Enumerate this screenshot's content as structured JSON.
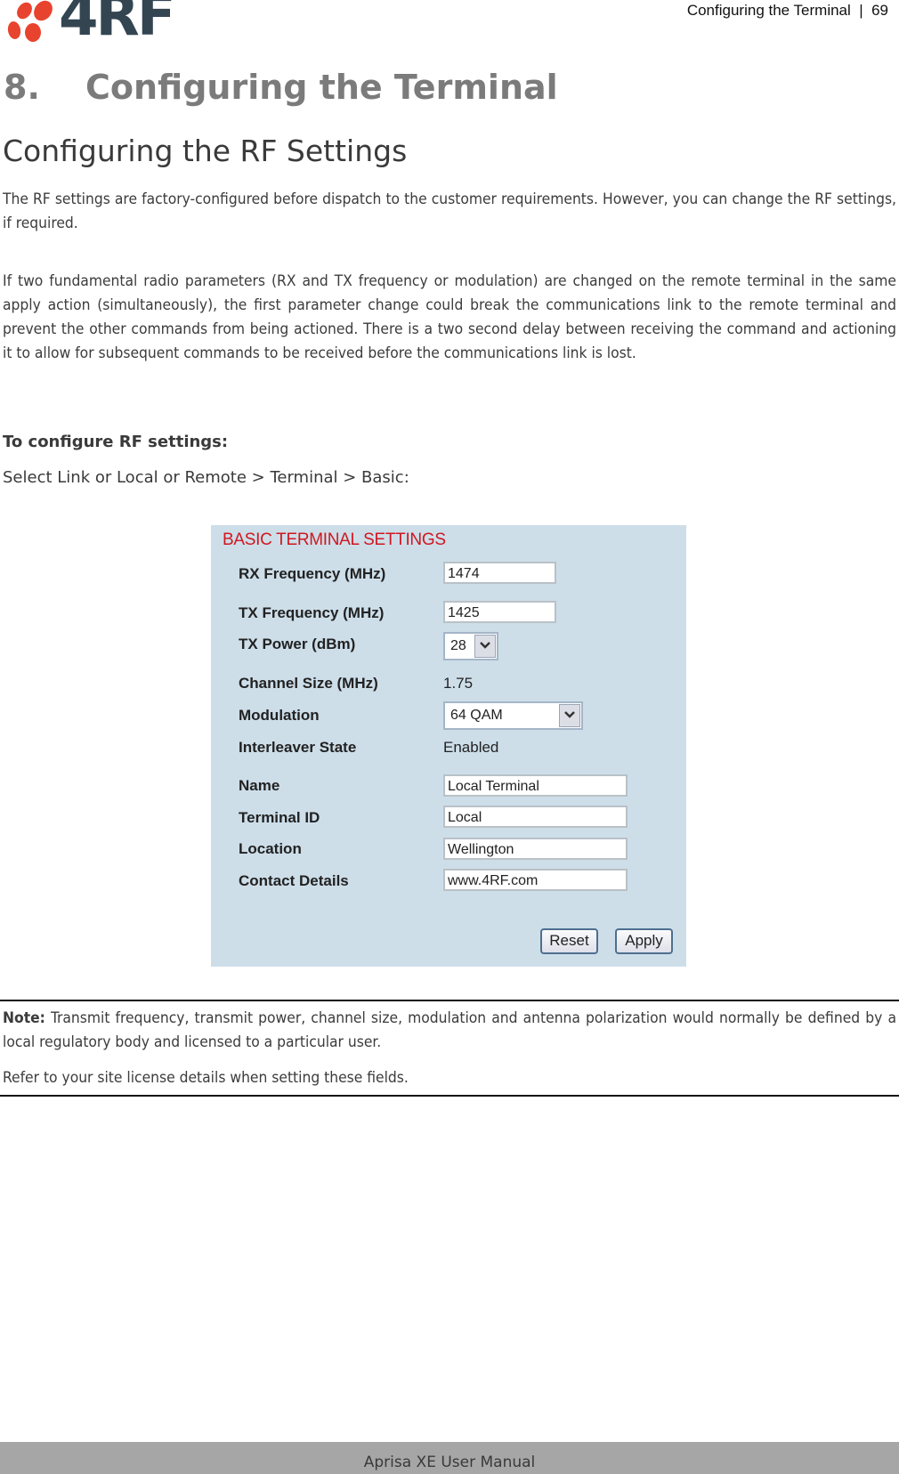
{
  "header": {
    "logo_text": "4RF",
    "running_head": "Configuring the Terminal  |  69"
  },
  "chapter": {
    "number": "8.",
    "title": "Configuring the Terminal"
  },
  "section": {
    "title": "Configuring the RF Settings"
  },
  "paragraphs": [
    "The RF settings are factory-configured before dispatch to the customer requirements. However, you can change the RF settings, if required.",
    "If two fundamental radio parameters (RX and TX frequency or modulation) are changed on the remote terminal in the same apply action (simultaneously), the first parameter change could break the communications link to the remote terminal and prevent the other commands from being actioned. There is a two second delay between receiving the command and actioning it to allow for subsequent commands to be received before the communications link is lost."
  ],
  "procedure": {
    "heading": "To configure RF settings:",
    "step": "Select Link or Local or Remote > Terminal > Basic:"
  },
  "panel": {
    "title": "BASIC TERMINAL SETTINGS",
    "rx_frequency": {
      "label": "RX Frequency (MHz)",
      "value": "1474"
    },
    "tx_frequency": {
      "label": "TX Frequency (MHz)",
      "value": "1425"
    },
    "tx_power": {
      "label": "TX Power (dBm)",
      "value": "28"
    },
    "channel_size": {
      "label": "Channel Size (MHz)",
      "value": "1.75"
    },
    "modulation": {
      "label": "Modulation",
      "value": "64 QAM"
    },
    "interleaver": {
      "label": "Interleaver State",
      "value": "Enabled"
    },
    "name": {
      "label": "Name",
      "value": "Local Terminal"
    },
    "terminal_id": {
      "label": "Terminal ID",
      "value": "Local"
    },
    "location": {
      "label": "Location",
      "value": "Wellington"
    },
    "contact": {
      "label": "Contact Details",
      "value": "www.4RF.com"
    },
    "reset_label": "Reset",
    "apply_label": "Apply",
    "colors": {
      "background": "#cddee9",
      "title": "#d0171f"
    }
  },
  "note": {
    "prefix": "Note:",
    "text": " Transmit frequency, transmit power, channel size, modulation and antenna polarization would normally be defined by a local regulatory body and licensed to a particular user.",
    "text2": "Refer to your site license details when setting these fields."
  },
  "footer": {
    "text": "Aprisa XE User Manual"
  }
}
